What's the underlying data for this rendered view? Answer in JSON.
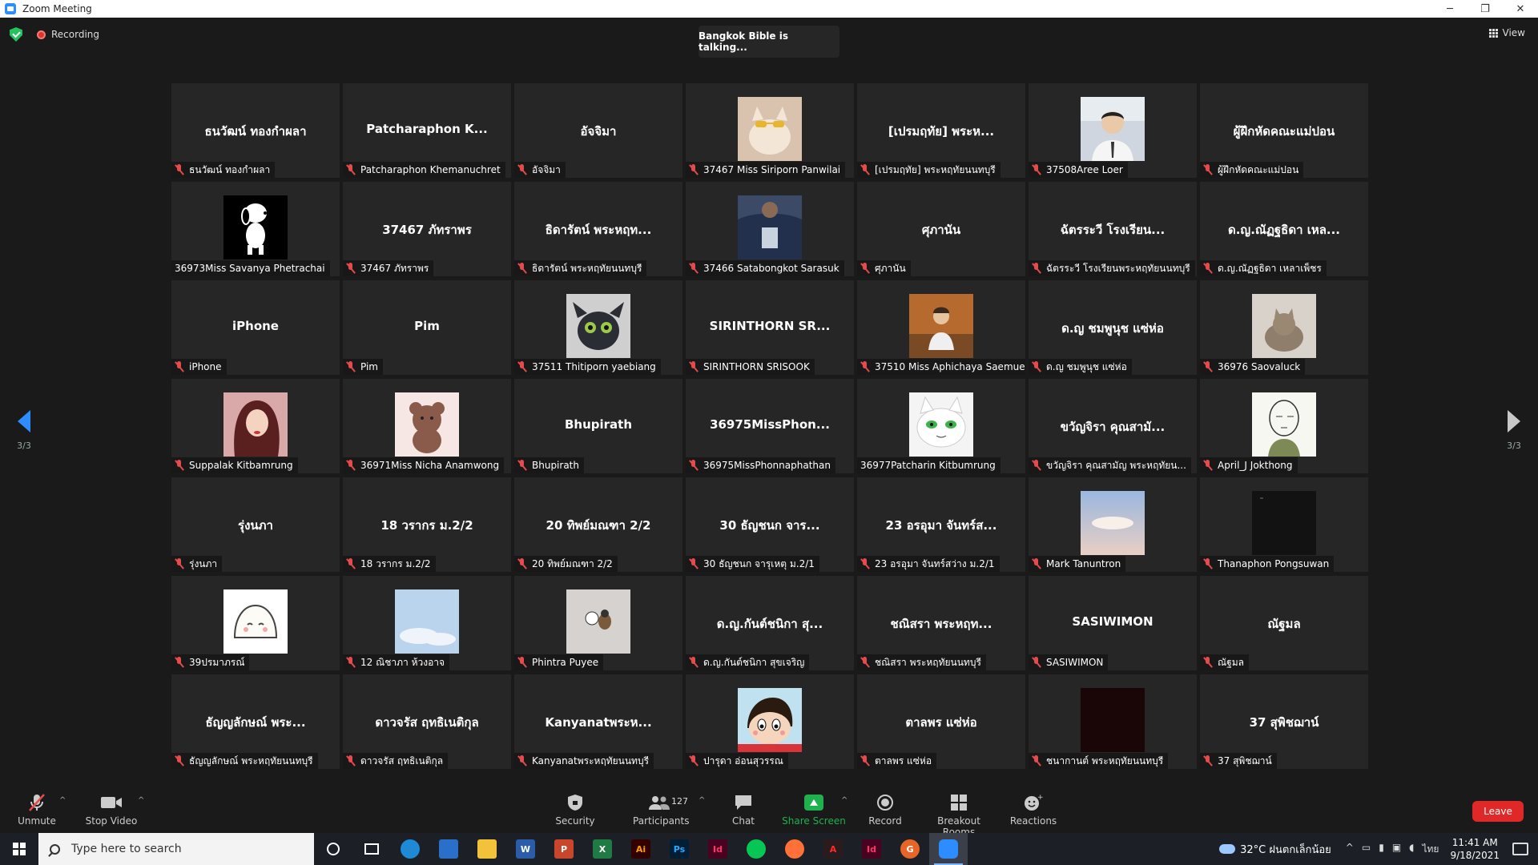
{
  "window": {
    "title": "Zoom Meeting",
    "minimize": "─",
    "maximize": "❐",
    "close": "✕"
  },
  "topbar": {
    "recording": "Recording",
    "talking": "Bangkok Bible is talking...",
    "view": "View"
  },
  "pager": {
    "left": "3/3",
    "right": "3/3"
  },
  "tiles": [
    {
      "big": "ธนวัฒน์ ทองกำผลา",
      "name": "ธนวัฒน์ ทองกำผลา",
      "muted": true
    },
    {
      "big": "Patcharaphon K...",
      "name": "Patcharaphon Khemanuchret",
      "muted": true
    },
    {
      "big": "อัจจิมา",
      "name": "อัจจิมา",
      "muted": true
    },
    {
      "big": "",
      "name": "37467 Miss Siriporn Panwilai",
      "muted": true,
      "avatar": "cat-photo"
    },
    {
      "big": "[เปรมฤทัย] พระห...",
      "name": "[เปรมฤทัย] พระหฤทัยนนทบุรี",
      "muted": true
    },
    {
      "big": "",
      "name": "37508Aree Loer",
      "muted": true,
      "avatar": "boy-photo"
    },
    {
      "big": "ผู้ฝึกหัดคณะแม่ปอน",
      "name": "ผู้ฝึกหัดคณะแม่ปอน",
      "muted": true
    },
    {
      "big": "",
      "name": "36973Miss Savanya Phetrachai",
      "muted": false,
      "avatar": "snoopy"
    },
    {
      "big": "37467 ภัทราพร",
      "name": "37467 ภัทราพร",
      "muted": true
    },
    {
      "big": "ธิดารัตน์ พระหฤท...",
      "name": "ธิดารัตน์ พระหฤทัยนนทบุรี",
      "muted": true
    },
    {
      "big": "",
      "name": "37466 Satabongkot Sarasuk",
      "muted": true,
      "avatar": "uniform-photo"
    },
    {
      "big": "ศุภานัน",
      "name": "ศุภานัน",
      "muted": true
    },
    {
      "big": "ฉัตรระวี โรงเรียน...",
      "name": "ฉัตรระวี โรงเรียนพระหฤทัยนนทบุรี",
      "muted": true
    },
    {
      "big": "ด.ญ.ณัฏฐธิดา เหล...",
      "name": "ด.ญ.ณัฏฐธิดา เหลาเพ็ชร",
      "muted": true
    },
    {
      "big": "iPhone",
      "name": "iPhone",
      "muted": true
    },
    {
      "big": "Pim",
      "name": "Pim",
      "muted": true
    },
    {
      "big": "",
      "name": "37511 Thitiporn yaebiang",
      "muted": true,
      "avatar": "dragon-toy"
    },
    {
      "big": "SIRINTHORN SR...",
      "name": "SIRINTHORN SRISOOK",
      "muted": true
    },
    {
      "big": "",
      "name": "37510 Miss Aphichaya Saemue",
      "muted": true,
      "avatar": "autumn-photo"
    },
    {
      "big": "ด.ญ ชมพูนุช แซ่ห่อ",
      "name": "ด.ญ ชมพูนุช แซ่ห่อ",
      "muted": true
    },
    {
      "big": "",
      "name": "36976 Saovaluck",
      "muted": true,
      "avatar": "cat2-photo"
    },
    {
      "big": "",
      "name": "Suppalak Kitbamrung",
      "muted": true,
      "avatar": "princess"
    },
    {
      "big": "",
      "name": "36971Miss Nicha Anamwong",
      "muted": true,
      "avatar": "bear"
    },
    {
      "big": "Bhupirath",
      "name": "Bhupirath",
      "muted": true
    },
    {
      "big": "36975MissPhon...",
      "name": "36975MissPhonnaphathan",
      "muted": true
    },
    {
      "big": "",
      "name": "36977Patcharin Kitbumrung",
      "muted": false,
      "avatar": "white-cat"
    },
    {
      "big": "ขวัญจิรา คุณสามั...",
      "name": "ขวัญจิรา คุณสามัญ พระหฤทัยน...",
      "muted": true
    },
    {
      "big": "",
      "name": "April_J Jokthong",
      "muted": true,
      "avatar": "sketch"
    },
    {
      "big": "รุ่งนภา",
      "name": "รุ่งนภา",
      "muted": true
    },
    {
      "big": "18 วรากร ม.2/2",
      "name": "18 วรากร ม.2/2",
      "muted": true
    },
    {
      "big": "20 ทิพย์มณฑา 2/2",
      "name": "20 ทิพย์มณฑา 2/2",
      "muted": true
    },
    {
      "big": "30 ธัญชนก จาร...",
      "name": "30 ธัญชนก จารุเหตุ ม.2/1",
      "muted": true
    },
    {
      "big": "23 อรอุมา จันทร์ส...",
      "name": "23 อรอุมา จันทร์สว่าง ม.2/1",
      "muted": true
    },
    {
      "big": "",
      "name": "Mark Tanuntron",
      "muted": true,
      "avatar": "sky-photo"
    },
    {
      "big": "",
      "name": "Thanaphon Pongsuwan",
      "muted": true,
      "avatar": "dark-photo"
    },
    {
      "big": "",
      "name": "39ปรมาภรณ์",
      "muted": true,
      "avatar": "blob"
    },
    {
      "big": "",
      "name": "12 ณิชาภา ห้วงอาจ",
      "muted": true,
      "avatar": "clouds"
    },
    {
      "big": "",
      "name": "Phintra Puyee",
      "muted": true,
      "avatar": "figurine"
    },
    {
      "big": "ด.ญ.กันต์ชนิกา สุ...",
      "name": "ด.ญ.กันต์ชนิกา สุขเจริญ",
      "muted": true
    },
    {
      "big": "ชณิสรา พระหฤท...",
      "name": "ชณิสรา พระหฤทัยนนทบุรี",
      "muted": true
    },
    {
      "big": "SASIWIMON",
      "name": "SASIWIMON",
      "muted": true
    },
    {
      "big": "ณัฐมล",
      "name": "ณัฐมล",
      "muted": true
    },
    {
      "big": "ธัญญลักษณ์ พระ...",
      "name": "ธัญญลักษณ์ พระหฤทัยนนทบุรี",
      "muted": true
    },
    {
      "big": "ดาวจรัส ฤทธิเนติกุล",
      "name": "ดาวจรัส ฤทธิเนติกุล",
      "muted": true
    },
    {
      "big": "Kanyanatพระห...",
      "name": "Kanyanatพระหฤทัยนนทบุรี",
      "muted": true
    },
    {
      "big": "",
      "name": "ปารุดา อ่อนสุวรรณ",
      "muted": true,
      "avatar": "shinchan"
    },
    {
      "big": "ตาลพร แซ่ห่อ",
      "name": "ตาลพร แซ่ห่อ",
      "muted": true
    },
    {
      "big": "",
      "name": "ชนากานต์ พระหฤทัยนนทบุรี",
      "muted": true,
      "avatar": "black-photo"
    },
    {
      "big": "37 สุพิชฌาน์",
      "name": "37 สุพิชฌาน์",
      "muted": true
    }
  ],
  "toolbar": {
    "unmute": "Unmute",
    "stop_video": "Stop Video",
    "security": "Security",
    "participants": "Participants",
    "participant_count": "127",
    "chat": "Chat",
    "share_screen": "Share Screen",
    "record": "Record",
    "breakout": "Breakout Rooms",
    "reactions": "Reactions",
    "leave": "Leave"
  },
  "taskbar": {
    "search_placeholder": "Type here to search",
    "weather": "32°C ฝนตกเล็กน้อย",
    "lang": "ไทย",
    "time": "11:41 AM",
    "date": "9/18/2021"
  },
  "colors": {
    "accent": "#2d8cff",
    "leave": "#e02828",
    "share": "#1fb14d",
    "muted": "#e64b4b"
  }
}
